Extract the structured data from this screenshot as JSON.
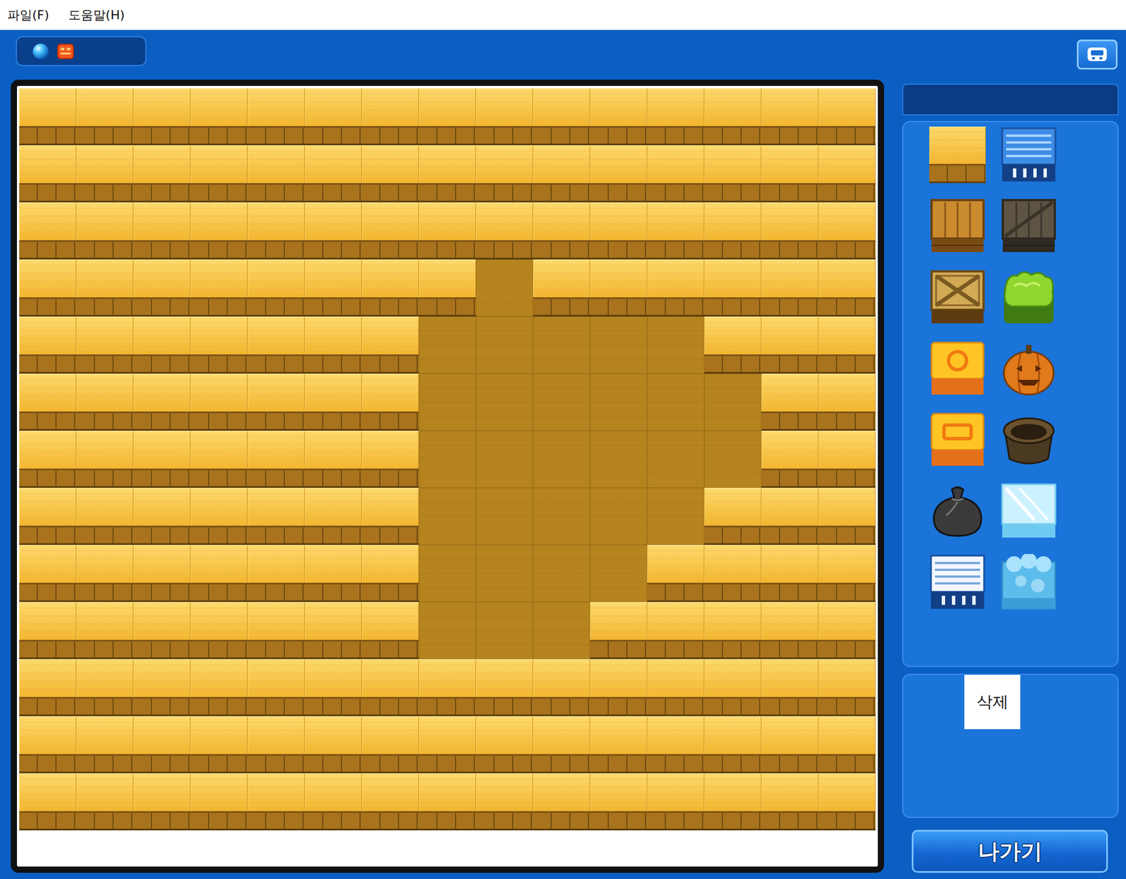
{
  "menu": [
    {
      "label": "파일(F)"
    },
    {
      "label": "도움말(H)"
    }
  ],
  "map": {
    "rows": [
      [
        "block",
        "block",
        "block",
        "block",
        "block",
        "block",
        "block",
        "block",
        "block",
        "block",
        "block",
        "block",
        "block",
        "block",
        "block"
      ],
      [
        "block",
        "block",
        "block",
        "block",
        "block",
        "block",
        "block",
        "block",
        "block",
        "block",
        "block",
        "block",
        "block",
        "block",
        "block"
      ],
      [
        "block",
        "block",
        "block",
        "block",
        "block",
        "block",
        "block",
        "block",
        "block",
        "block",
        "block",
        "block",
        "block",
        "block",
        "block"
      ],
      [
        "block",
        "block",
        "block",
        "block",
        "block",
        "block",
        "block",
        "block",
        "floor",
        "block",
        "block",
        "block",
        "block",
        "block",
        "block"
      ],
      [
        "block",
        "block",
        "block",
        "block",
        "block",
        "block",
        "block",
        "floor",
        "floor",
        "floor",
        "floor",
        "floor",
        "block",
        "block",
        "block"
      ],
      [
        "block",
        "block",
        "block",
        "block",
        "block",
        "block",
        "block",
        "floor",
        "floor",
        "floor",
        "floor",
        "floor",
        "floor",
        "block",
        "block"
      ],
      [
        "block",
        "block",
        "block",
        "block",
        "block",
        "block",
        "block",
        "floor",
        "floor",
        "floor",
        "floor",
        "floor",
        "floor",
        "block",
        "block"
      ],
      [
        "block",
        "block",
        "block",
        "block",
        "block",
        "block",
        "block",
        "floor",
        "floor",
        "floor",
        "floor",
        "floor",
        "block",
        "block",
        "block"
      ],
      [
        "block",
        "block",
        "block",
        "block",
        "block",
        "block",
        "block",
        "floor",
        "floor",
        "floor",
        "floor",
        "block",
        "block",
        "block",
        "block"
      ],
      [
        "block",
        "block",
        "block",
        "block",
        "block",
        "block",
        "block",
        "floor",
        "floor",
        "floor",
        "block",
        "block",
        "block",
        "block",
        "block"
      ],
      [
        "block",
        "block",
        "block",
        "block",
        "block",
        "block",
        "block",
        "block",
        "block",
        "block",
        "block",
        "block",
        "block",
        "block",
        "block"
      ],
      [
        "block",
        "block",
        "block",
        "block",
        "block",
        "block",
        "block",
        "block",
        "block",
        "block",
        "block",
        "block",
        "block",
        "block",
        "block"
      ],
      [
        "block",
        "block",
        "block",
        "block",
        "block",
        "block",
        "block",
        "block",
        "block",
        "block",
        "block",
        "block",
        "block",
        "block",
        "block"
      ]
    ]
  },
  "palette": [
    {
      "kind": "yellow-block"
    },
    {
      "kind": "blue-shelf"
    },
    {
      "kind": "wood-crate"
    },
    {
      "kind": "dark-crate"
    },
    {
      "kind": "x-crate"
    },
    {
      "kind": "bush"
    },
    {
      "kind": "ring-box"
    },
    {
      "kind": "pumpkin"
    },
    {
      "kind": "slot-box"
    },
    {
      "kind": "pot"
    },
    {
      "kind": "sack"
    },
    {
      "kind": "ice-block"
    },
    {
      "kind": "white-shelf"
    },
    {
      "kind": "cloud-block"
    }
  ],
  "delete_button": "삭제",
  "exit_button": "나가기"
}
